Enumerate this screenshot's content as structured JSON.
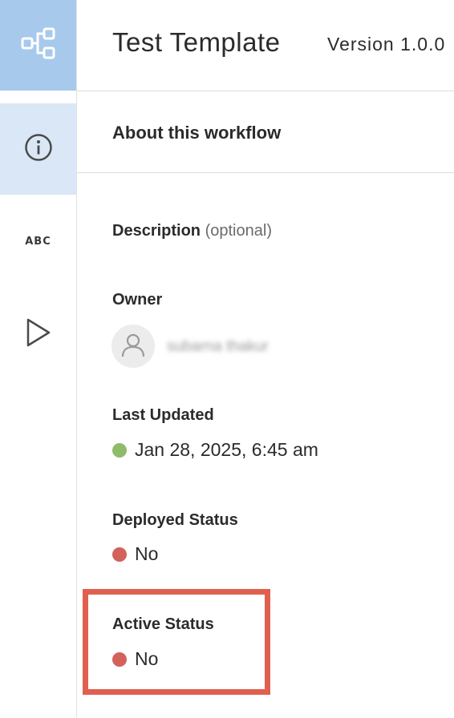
{
  "rail": {
    "items": [
      {
        "name": "workflow",
        "icon": "workflow-diagram-icon"
      },
      {
        "name": "info",
        "icon": "info-icon"
      },
      {
        "name": "abc",
        "icon": "abc-text-icon",
        "label": "ABC"
      },
      {
        "name": "run",
        "icon": "play-icon"
      }
    ]
  },
  "header": {
    "title": "Test Template",
    "version": "Version 1.0.0"
  },
  "section": {
    "title": "About this workflow"
  },
  "fields": {
    "description": {
      "label": "Description",
      "hint": "(optional)"
    },
    "owner": {
      "label": "Owner",
      "name": "subarna thakur"
    },
    "last_updated": {
      "label": "Last Updated",
      "value": "Jan 28, 2025, 6:45 am",
      "status_color": "#8fbc6a"
    },
    "deployed_status": {
      "label": "Deployed Status",
      "value": "No",
      "status_color": "#d2625a"
    },
    "active_status": {
      "label": "Active Status",
      "value": "No",
      "status_color": "#d2625a"
    }
  },
  "colors": {
    "rail_active": "#a7c9ec",
    "rail_selected": "#d9e7f7",
    "highlight": "#e0604f"
  }
}
